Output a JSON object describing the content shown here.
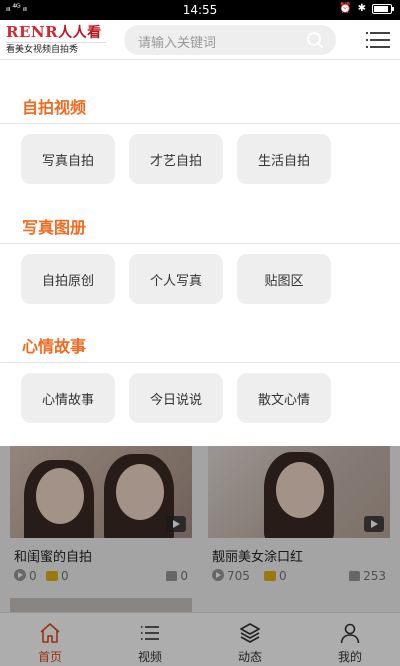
{
  "status_bar": {
    "signal": "ᵢₗₗ ⁴ᴳ ᵢₗₗ",
    "time": "14:55",
    "battery_level": 0.85,
    "icons": [
      "alarm-icon",
      "bluetooth-icon",
      "battery-icon"
    ]
  },
  "header": {
    "logo_brand": "RENR",
    "logo_brand_cn": "人人看",
    "logo_slogan": "看美女视频自拍秀",
    "search_placeholder": "请输入关键词",
    "menu_icon": "list-menu-icon"
  },
  "categories": [
    {
      "title": "自拍视频",
      "tags": [
        "写真自拍",
        "才艺自拍",
        "生活自拍"
      ]
    },
    {
      "title": "写真图册",
      "tags": [
        "自拍原创",
        "个人写真",
        "贴图区"
      ]
    },
    {
      "title": "心情故事",
      "tags": [
        "心情故事",
        "今日说说",
        "散文心情"
      ]
    }
  ],
  "feed": [
    {
      "title": "和闺蜜的自拍",
      "views": "0",
      "coins": "0",
      "likes": "0"
    },
    {
      "title": "靓丽美女涂口红",
      "views": "705",
      "coins": "0",
      "likes": "253"
    }
  ],
  "tabbar": {
    "items": [
      {
        "label": "首页",
        "icon": "home-icon",
        "active": true
      },
      {
        "label": "视频",
        "icon": "video-list-icon",
        "active": false
      },
      {
        "label": "动态",
        "icon": "layers-icon",
        "active": false
      },
      {
        "label": "我的",
        "icon": "user-icon",
        "active": false
      }
    ]
  },
  "colors": {
    "accent": "#f26b21",
    "brand_red": "#d8262d",
    "active_tab": "#e04a1f",
    "tag_bg": "#eeeeee"
  }
}
